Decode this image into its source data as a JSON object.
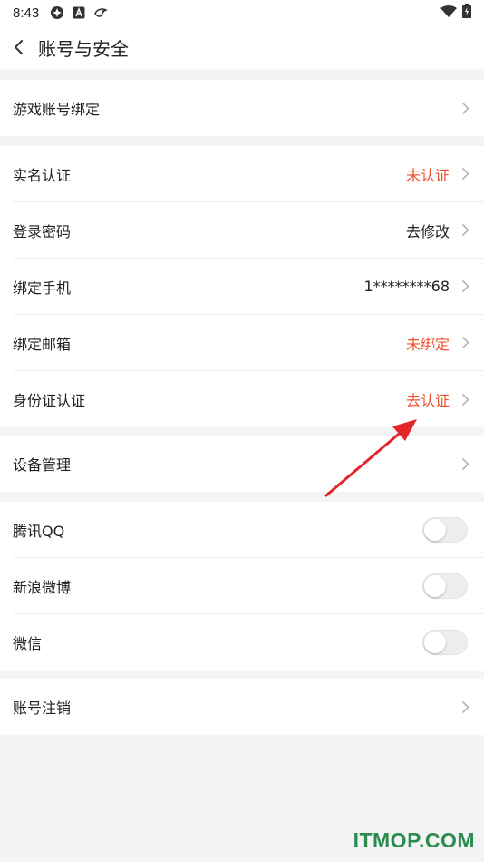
{
  "status_bar": {
    "time": "8:43"
  },
  "header": {
    "title": "账号与安全"
  },
  "groups": [
    {
      "items": [
        {
          "label": "游戏账号绑定",
          "value": ""
        }
      ]
    },
    {
      "items": [
        {
          "label": "实名认证",
          "value": "未认证",
          "value_color": "#f0502d"
        },
        {
          "label": "登录密码",
          "value": "去修改"
        },
        {
          "label": "绑定手机",
          "value": "1********68"
        },
        {
          "label": "绑定邮箱",
          "value": "未绑定",
          "value_color": "#f0502d"
        },
        {
          "label": "身份证认证",
          "value": "去认证",
          "value_color": "#f0502d"
        }
      ]
    },
    {
      "items": [
        {
          "label": "设备管理",
          "value": ""
        }
      ]
    },
    {
      "items": [
        {
          "label": "腾讯QQ",
          "toggle": false
        },
        {
          "label": "新浪微博",
          "toggle": false
        },
        {
          "label": "微信",
          "toggle": false
        }
      ]
    },
    {
      "items": [
        {
          "label": "账号注销",
          "value": ""
        }
      ]
    }
  ],
  "annotation": {
    "type": "red-arrow",
    "color": "#e3262b",
    "points_to": "去认证"
  },
  "watermark": "ITMOP.COM",
  "colors": {
    "accent_red": "#f0502d",
    "background": "#f2f4f5",
    "watermark": "#2b8c4e"
  }
}
